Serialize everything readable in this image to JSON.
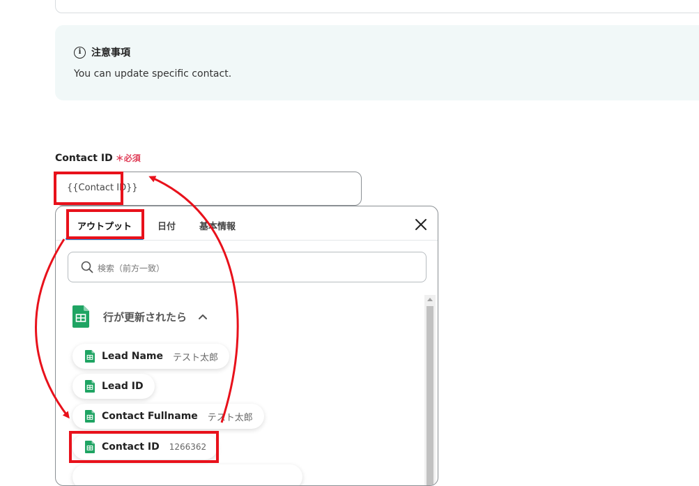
{
  "notice": {
    "title": "注意事項",
    "body": "You can update specific contact."
  },
  "field": {
    "label": "Contact ID",
    "required": "＊必須",
    "value": "{{Contact ID}}"
  },
  "popup": {
    "tabs": [
      {
        "label": "アウトプット",
        "active": true
      },
      {
        "label": "日付",
        "active": false
      },
      {
        "label": "基本情報",
        "active": false
      }
    ],
    "search_placeholder": "検索（前方一致）",
    "section_title": "行が更新されたら",
    "items": [
      {
        "name": "Lead Name",
        "value": "テスト太郎"
      },
      {
        "name": "Lead ID",
        "value": ""
      },
      {
        "name": "Contact Fullname",
        "value": "テスト太郎"
      },
      {
        "name": "Contact ID",
        "value": "1266362"
      }
    ]
  },
  "colors": {
    "accent_tab": "#1c7bd8",
    "highlight": "#e8111b",
    "required": "#e0405a",
    "sheets_green": "#1fa463",
    "notice_bg": "#f1f8f8"
  },
  "icons": [
    "info-icon",
    "close-icon",
    "search-icon",
    "google-sheets-icon",
    "chevron-up-icon"
  ]
}
